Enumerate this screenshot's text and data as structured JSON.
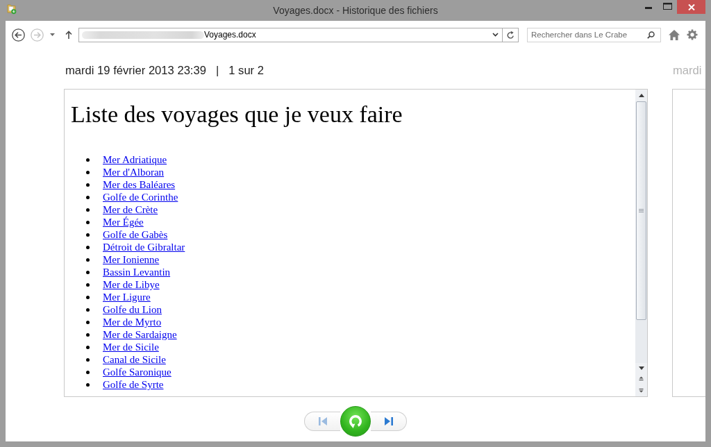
{
  "window": {
    "title": "Voyages.docx - Historique des fichiers"
  },
  "toolbar": {
    "back": {
      "disabled": false
    },
    "forward": {
      "disabled": true
    },
    "address": {
      "value": "Voyages.docx"
    },
    "search": {
      "placeholder": "Rechercher dans Le Crabe"
    }
  },
  "current_version": {
    "date": "mardi 19 février 2013 23:39",
    "separator": "|",
    "position": "1 sur 2",
    "document": {
      "heading": "Liste des voyages que je veux faire",
      "items": [
        "Mer Adriatique",
        "Mer d'Alboran",
        "Mer des Baléares",
        "Golfe de Corinthe",
        "Mer de Crète",
        "Mer Égée",
        "Golfe de Gabès",
        "Détroit de Gibraltar",
        "Mer Ionienne",
        "Bassin Levantin",
        "Mer de Libye",
        "Mer Ligure",
        "Golfe du Lion",
        "Mer de Myrto",
        "Mer de Sardaigne",
        "Mer de Sicile",
        "Canal de Sicile",
        "Golfe Saronique",
        "Golfe de Syrte"
      ]
    }
  },
  "next_version": {
    "date": "mardi"
  },
  "navigation": {
    "previous": {
      "disabled": true
    },
    "next": {
      "disabled": false
    }
  }
}
